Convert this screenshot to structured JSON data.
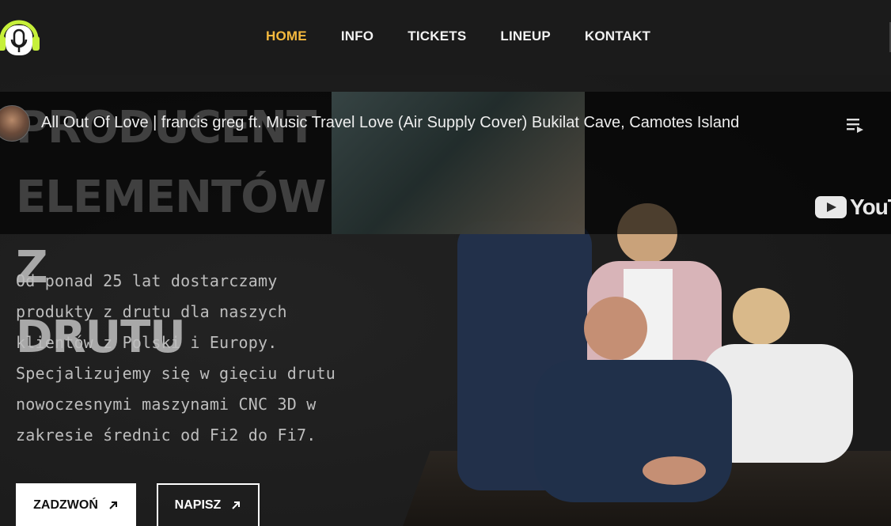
{
  "nav": {
    "items": [
      {
        "label": "HOME",
        "active": true
      },
      {
        "label": "INFO",
        "active": false
      },
      {
        "label": "TICKETS",
        "active": false
      },
      {
        "label": "LINEUP",
        "active": false
      },
      {
        "label": "KONTAKT",
        "active": false
      }
    ]
  },
  "hero": {
    "title": "PRODUCENT\nELEMENTÓW Z\nDRUTU",
    "description": "Od ponad 25 lat dostarczamy produkty z drutu dla naszych klientów z Polski i Europy. Specjalizujemy się w gięciu drutu nowoczesnymi maszynami CNC 3D w zakresie średnic od Fi2 do Fi7.",
    "call_label": "ZADZWOŃ",
    "write_label": "NAPISZ"
  },
  "video": {
    "title": "All Out Of Love | francis greg ft. Music Travel Love (Air Supply Cover) Bukilat Cave, Camotes Island",
    "brand": "YouTu"
  },
  "icons": {
    "logo": "microphone-headphones-icon",
    "arrow": "arrow-up-right-icon",
    "playlist": "playlist-icon",
    "youtube": "youtube-play-icon"
  },
  "colors": {
    "accent": "#f5b93e",
    "logo_green": "#c6f03a"
  }
}
